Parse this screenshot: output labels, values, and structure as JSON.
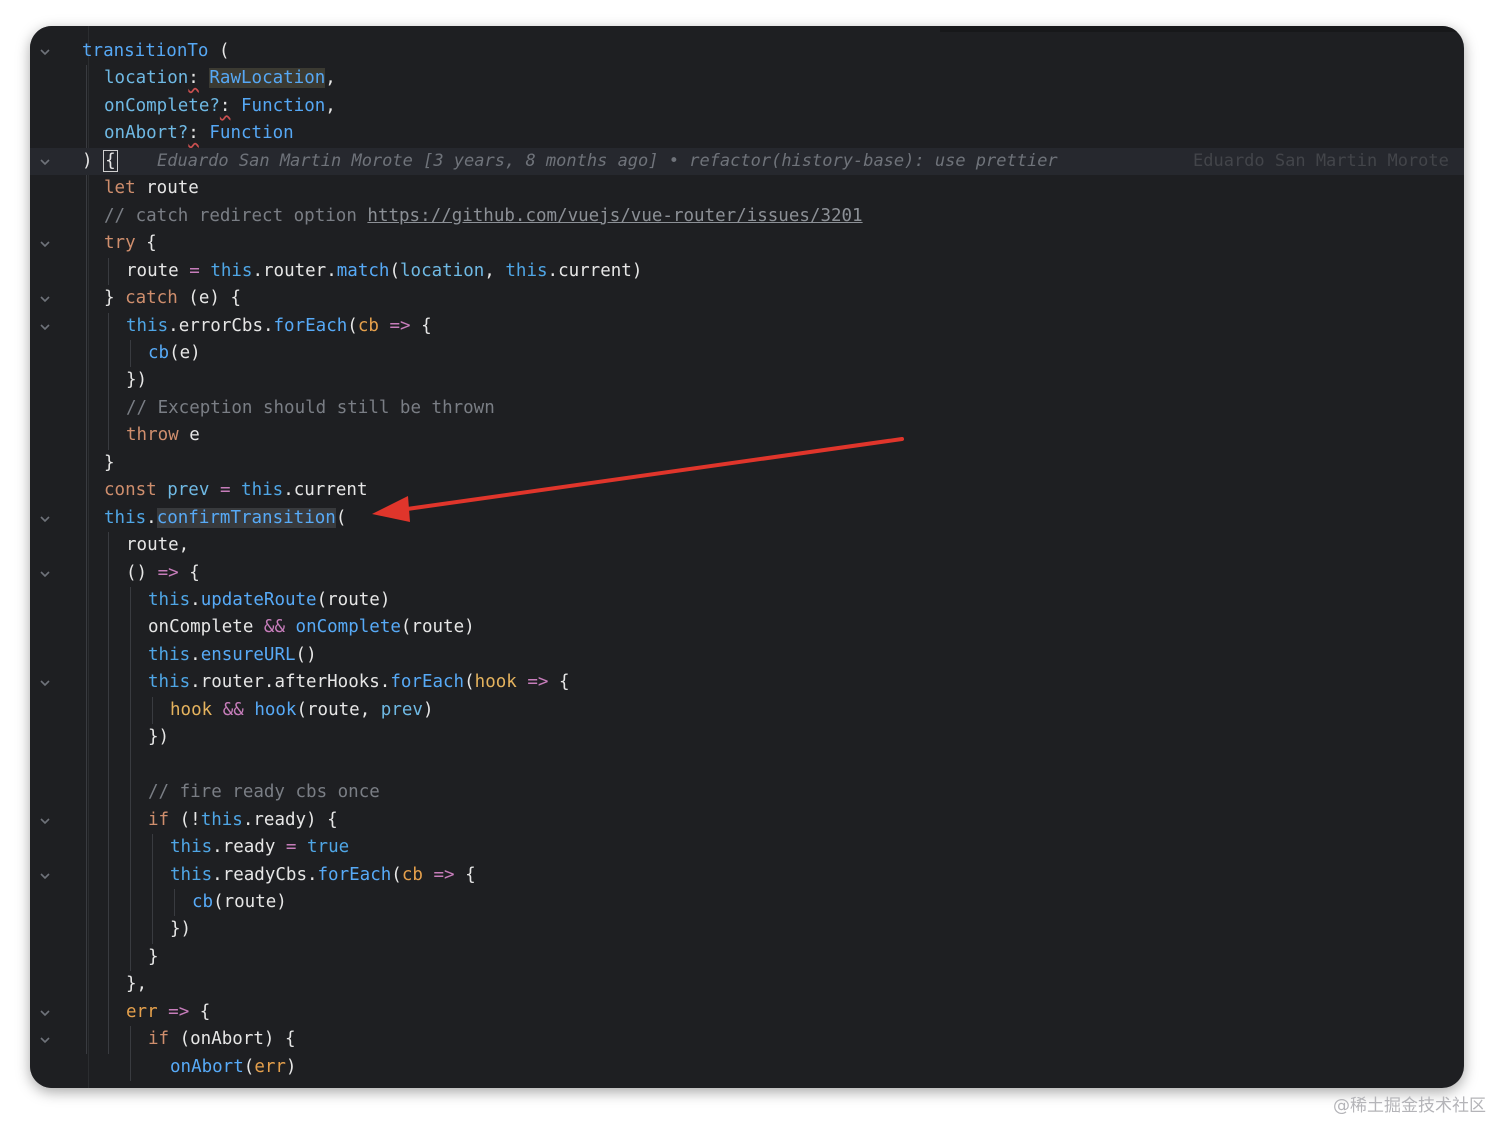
{
  "editor": {
    "lines": [
      {
        "segs": [
          [
            "fn",
            "transitionTo"
          ],
          [
            "plain",
            " ("
          ]
        ]
      },
      {
        "segs": [
          [
            "param",
            "location"
          ],
          [
            "squig",
            ":"
          ],
          [
            "plain",
            " "
          ],
          [
            "type-hl",
            "RawLocation"
          ],
          [
            "plain",
            ","
          ]
        ]
      },
      {
        "segs": [
          [
            "param",
            "onComplete?"
          ],
          [
            "squig",
            ":"
          ],
          [
            "plain",
            " "
          ],
          [
            "type",
            "Function"
          ],
          [
            "plain",
            ","
          ]
        ]
      },
      {
        "segs": [
          [
            "param",
            "onAbort?"
          ],
          [
            "squig",
            ":"
          ],
          [
            "plain",
            " "
          ],
          [
            "type",
            "Function"
          ]
        ]
      },
      {
        "segs": [
          [
            "plain",
            ") "
          ],
          [
            "caret",
            "{"
          ]
        ]
      },
      {
        "segs": [
          [
            "kw",
            "let"
          ],
          [
            "plain",
            " route"
          ]
        ]
      },
      {
        "segs": [
          [
            "cmt",
            "// catch redirect option "
          ],
          [
            "link",
            "https://github.com/vuejs/vue-router/issues/3201"
          ]
        ]
      },
      {
        "segs": [
          [
            "kw",
            "try"
          ],
          [
            "plain",
            " {"
          ]
        ]
      },
      {
        "segs": [
          [
            "plain",
            "route "
          ],
          [
            "op",
            "="
          ],
          [
            "plain",
            " "
          ],
          [
            "this",
            "this"
          ],
          [
            "plain",
            ".router."
          ],
          [
            "method",
            "match"
          ],
          [
            "plain",
            "("
          ],
          [
            "param",
            "location"
          ],
          [
            "plain",
            ", "
          ],
          [
            "this",
            "this"
          ],
          [
            "plain",
            ".current)"
          ]
        ]
      },
      {
        "segs": [
          [
            "plain",
            "} "
          ],
          [
            "kw",
            "catch"
          ],
          [
            "plain",
            " (e) {"
          ]
        ]
      },
      {
        "segs": [
          [
            "this",
            "this"
          ],
          [
            "plain",
            ".errorCbs."
          ],
          [
            "method",
            "forEach"
          ],
          [
            "plain",
            "("
          ],
          [
            "cbp",
            "cb"
          ],
          [
            "plain",
            " "
          ],
          [
            "op",
            "=>"
          ],
          [
            "plain",
            " {"
          ]
        ]
      },
      {
        "segs": [
          [
            "method",
            "cb"
          ],
          [
            "plain",
            "(e)"
          ]
        ]
      },
      {
        "segs": [
          [
            "plain",
            "})"
          ]
        ]
      },
      {
        "segs": [
          [
            "cmt",
            "// Exception should still be thrown"
          ]
        ]
      },
      {
        "segs": [
          [
            "kw",
            "throw"
          ],
          [
            "plain",
            " e"
          ]
        ]
      },
      {
        "segs": [
          [
            "plain",
            "}"
          ]
        ]
      },
      {
        "segs": [
          [
            "kw",
            "const"
          ],
          [
            "plain",
            " "
          ],
          [
            "param",
            "prev"
          ],
          [
            "plain",
            " "
          ],
          [
            "op",
            "="
          ],
          [
            "plain",
            " "
          ],
          [
            "this",
            "this"
          ],
          [
            "plain",
            ".current"
          ]
        ]
      },
      {
        "segs": [
          [
            "this",
            "this"
          ],
          [
            "plain",
            "."
          ],
          [
            "method-hl",
            "confirmTransition"
          ],
          [
            "plain",
            "("
          ]
        ]
      },
      {
        "segs": [
          [
            "plain",
            "route,"
          ]
        ]
      },
      {
        "segs": [
          [
            "plain",
            "() "
          ],
          [
            "op",
            "=>"
          ],
          [
            "plain",
            " {"
          ]
        ]
      },
      {
        "segs": [
          [
            "this",
            "this"
          ],
          [
            "plain",
            "."
          ],
          [
            "method",
            "updateRoute"
          ],
          [
            "plain",
            "(route)"
          ]
        ]
      },
      {
        "segs": [
          [
            "plain",
            "onComplete "
          ],
          [
            "op",
            "&&"
          ],
          [
            "plain",
            " "
          ],
          [
            "method",
            "onComplete"
          ],
          [
            "plain",
            "(route)"
          ]
        ]
      },
      {
        "segs": [
          [
            "this",
            "this"
          ],
          [
            "plain",
            "."
          ],
          [
            "method",
            "ensureURL"
          ],
          [
            "plain",
            "()"
          ]
        ]
      },
      {
        "segs": [
          [
            "this",
            "this"
          ],
          [
            "plain",
            ".router.afterHooks."
          ],
          [
            "method",
            "forEach"
          ],
          [
            "plain",
            "("
          ],
          [
            "hook",
            "hook"
          ],
          [
            "plain",
            " "
          ],
          [
            "op",
            "=>"
          ],
          [
            "plain",
            " {"
          ]
        ]
      },
      {
        "segs": [
          [
            "hook",
            "hook"
          ],
          [
            "plain",
            " "
          ],
          [
            "op",
            "&&"
          ],
          [
            "plain",
            " "
          ],
          [
            "method",
            "hook"
          ],
          [
            "plain",
            "(route, "
          ],
          [
            "param",
            "prev"
          ],
          [
            "plain",
            ")"
          ]
        ]
      },
      {
        "segs": [
          [
            "plain",
            "})"
          ]
        ]
      },
      {
        "segs": []
      },
      {
        "segs": [
          [
            "cmt",
            "// fire ready cbs once"
          ]
        ]
      },
      {
        "segs": [
          [
            "kw",
            "if"
          ],
          [
            "plain",
            " (!"
          ],
          [
            "this",
            "this"
          ],
          [
            "plain",
            ".ready) {"
          ]
        ]
      },
      {
        "segs": [
          [
            "this",
            "this"
          ],
          [
            "plain",
            ".ready "
          ],
          [
            "op",
            "="
          ],
          [
            "plain",
            " "
          ],
          [
            "bool",
            "true"
          ]
        ]
      },
      {
        "segs": [
          [
            "this",
            "this"
          ],
          [
            "plain",
            ".readyCbs."
          ],
          [
            "method",
            "forEach"
          ],
          [
            "plain",
            "("
          ],
          [
            "cbp",
            "cb"
          ],
          [
            "plain",
            " "
          ],
          [
            "op",
            "=>"
          ],
          [
            "plain",
            " {"
          ]
        ]
      },
      {
        "segs": [
          [
            "method",
            "cb"
          ],
          [
            "plain",
            "(route)"
          ]
        ]
      },
      {
        "segs": [
          [
            "plain",
            "})"
          ]
        ]
      },
      {
        "segs": [
          [
            "plain",
            "}"
          ]
        ]
      },
      {
        "segs": [
          [
            "plain",
            "},"
          ]
        ]
      },
      {
        "segs": [
          [
            "cbp",
            "err"
          ],
          [
            "plain",
            " "
          ],
          [
            "op",
            "=>"
          ],
          [
            "plain",
            " {"
          ]
        ]
      },
      {
        "segs": [
          [
            "kw",
            "if"
          ],
          [
            "plain",
            " (onAbort) {"
          ]
        ]
      },
      {
        "segs": [
          [
            "method",
            "onAbort"
          ],
          [
            "plain",
            "("
          ],
          [
            "cbp",
            "err"
          ],
          [
            "plain",
            ")"
          ]
        ]
      }
    ],
    "blame_inline": "Eduardo San Martin Morote [3 years, 8 months ago] • refactor(history-base): use prettier",
    "blame_right": "Eduardo San Martin Morote",
    "fold_icon": "chevron-down-icon",
    "annotation_arrow_color": "#e0352b"
  },
  "watermark": "@稀土掘金技术社区"
}
